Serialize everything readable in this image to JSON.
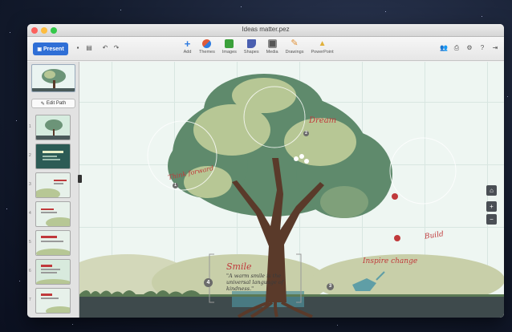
{
  "window": {
    "title": "Ideas matter.pez"
  },
  "toolbar": {
    "present_label": "Present",
    "insert_items": [
      {
        "label": "Add",
        "icon": "plus-icon",
        "color": "#2f7be0"
      },
      {
        "label": "Themes",
        "icon": "themes-icon",
        "color": "#e05a3a"
      },
      {
        "label": "Images",
        "icon": "images-icon",
        "color": "#3aa03a"
      },
      {
        "label": "Shapes",
        "icon": "shapes-icon",
        "color": "#4a5fb0"
      },
      {
        "label": "Media",
        "icon": "media-icon",
        "color": "#555555"
      },
      {
        "label": "Drawings",
        "icon": "drawings-icon",
        "color": "#e0923a"
      },
      {
        "label": "PowerPoint",
        "icon": "powerpoint-icon",
        "color": "#e0b03a"
      }
    ]
  },
  "sidebar": {
    "edit_path_label": "Edit Path",
    "slides": [
      {
        "number": "1",
        "bg": "#d6ecdf"
      },
      {
        "number": "2",
        "bg": "#2c5b55"
      },
      {
        "number": "3",
        "bg": "#e7f1ea"
      },
      {
        "number": "4",
        "bg": "#e7f1ea"
      },
      {
        "number": "5",
        "bg": "#e7f1ea"
      },
      {
        "number": "6",
        "bg": "#d8eadd"
      },
      {
        "number": "7",
        "bg": "#e7f1ea"
      }
    ]
  },
  "canvas": {
    "labels": {
      "dream": "Dream",
      "think_forward": "Think forward",
      "build": "Build",
      "smile": "Smile",
      "smile_quote": "\"A warm smile is the universal language of kindness.\"",
      "inspire_change": "Inspire change"
    },
    "markers": {
      "think_forward": "1",
      "dream": "2",
      "smile": "4",
      "inspire_change": "3"
    }
  },
  "colors": {
    "accent": "#2f6fd6",
    "headline_red": "#c0393b",
    "foliage_dark": "#5f8a6c",
    "foliage_light": "#b7c795"
  }
}
